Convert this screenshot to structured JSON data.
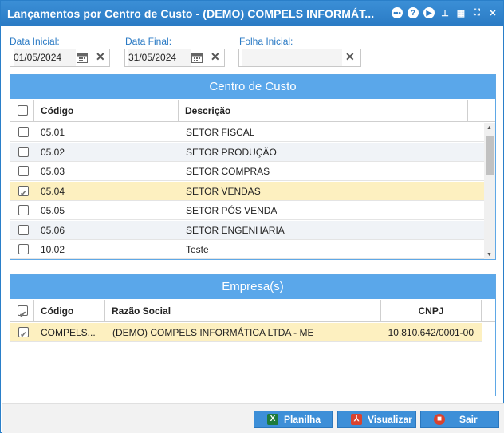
{
  "window": {
    "title": "Lançamentos por Centro de Custo - (DEMO) COMPELS INFORMÁT..."
  },
  "toolbar_icons": [
    "chat-icon",
    "help-icon",
    "play-icon",
    "stamp-icon",
    "calendar-icon",
    "fullscreen-icon",
    "close-icon"
  ],
  "filters": {
    "data_inicial": {
      "label": "Data Inicial:",
      "value": "01/05/2024"
    },
    "data_final": {
      "label": "Data Final:",
      "value": "31/05/2024"
    },
    "folha_inicial": {
      "label": "Folha Inicial:",
      "value": ""
    }
  },
  "centro_custo": {
    "title": "Centro de Custo",
    "columns": {
      "codigo": "Código",
      "descricao": "Descrição"
    },
    "rows": [
      {
        "codigo": "05.01",
        "descricao": "SETOR FISCAL",
        "checked": false
      },
      {
        "codigo": "05.02",
        "descricao": "SETOR PRODUÇÃO",
        "checked": false
      },
      {
        "codigo": "05.03",
        "descricao": "SETOR COMPRAS",
        "checked": false
      },
      {
        "codigo": "05.04",
        "descricao": "SETOR VENDAS",
        "checked": true
      },
      {
        "codigo": "05.05",
        "descricao": "SETOR PÓS VENDA",
        "checked": false
      },
      {
        "codigo": "05.06",
        "descricao": "SETOR ENGENHARIA",
        "checked": false
      },
      {
        "codigo": "10.02",
        "descricao": "Teste",
        "checked": false
      }
    ]
  },
  "empresas": {
    "title": "Empresa(s)",
    "columns": {
      "codigo": "Código",
      "razao": "Razão Social",
      "cnpj": "CNPJ"
    },
    "rows": [
      {
        "codigo": "COMPELS...",
        "razao": "(DEMO) COMPELS INFORMÁTICA LTDA - ME",
        "cnpj": "10.810.642/0001-00",
        "checked": true
      }
    ]
  },
  "buttons": {
    "planilha": "Planilha",
    "visualizar": "Visualizar",
    "sair": "Sair"
  },
  "colors": {
    "title_bar": "#2a7ac4",
    "panel_header": "#5aa7ea",
    "selected_row": "#fdf0c0",
    "button": "#3d8fd8"
  }
}
